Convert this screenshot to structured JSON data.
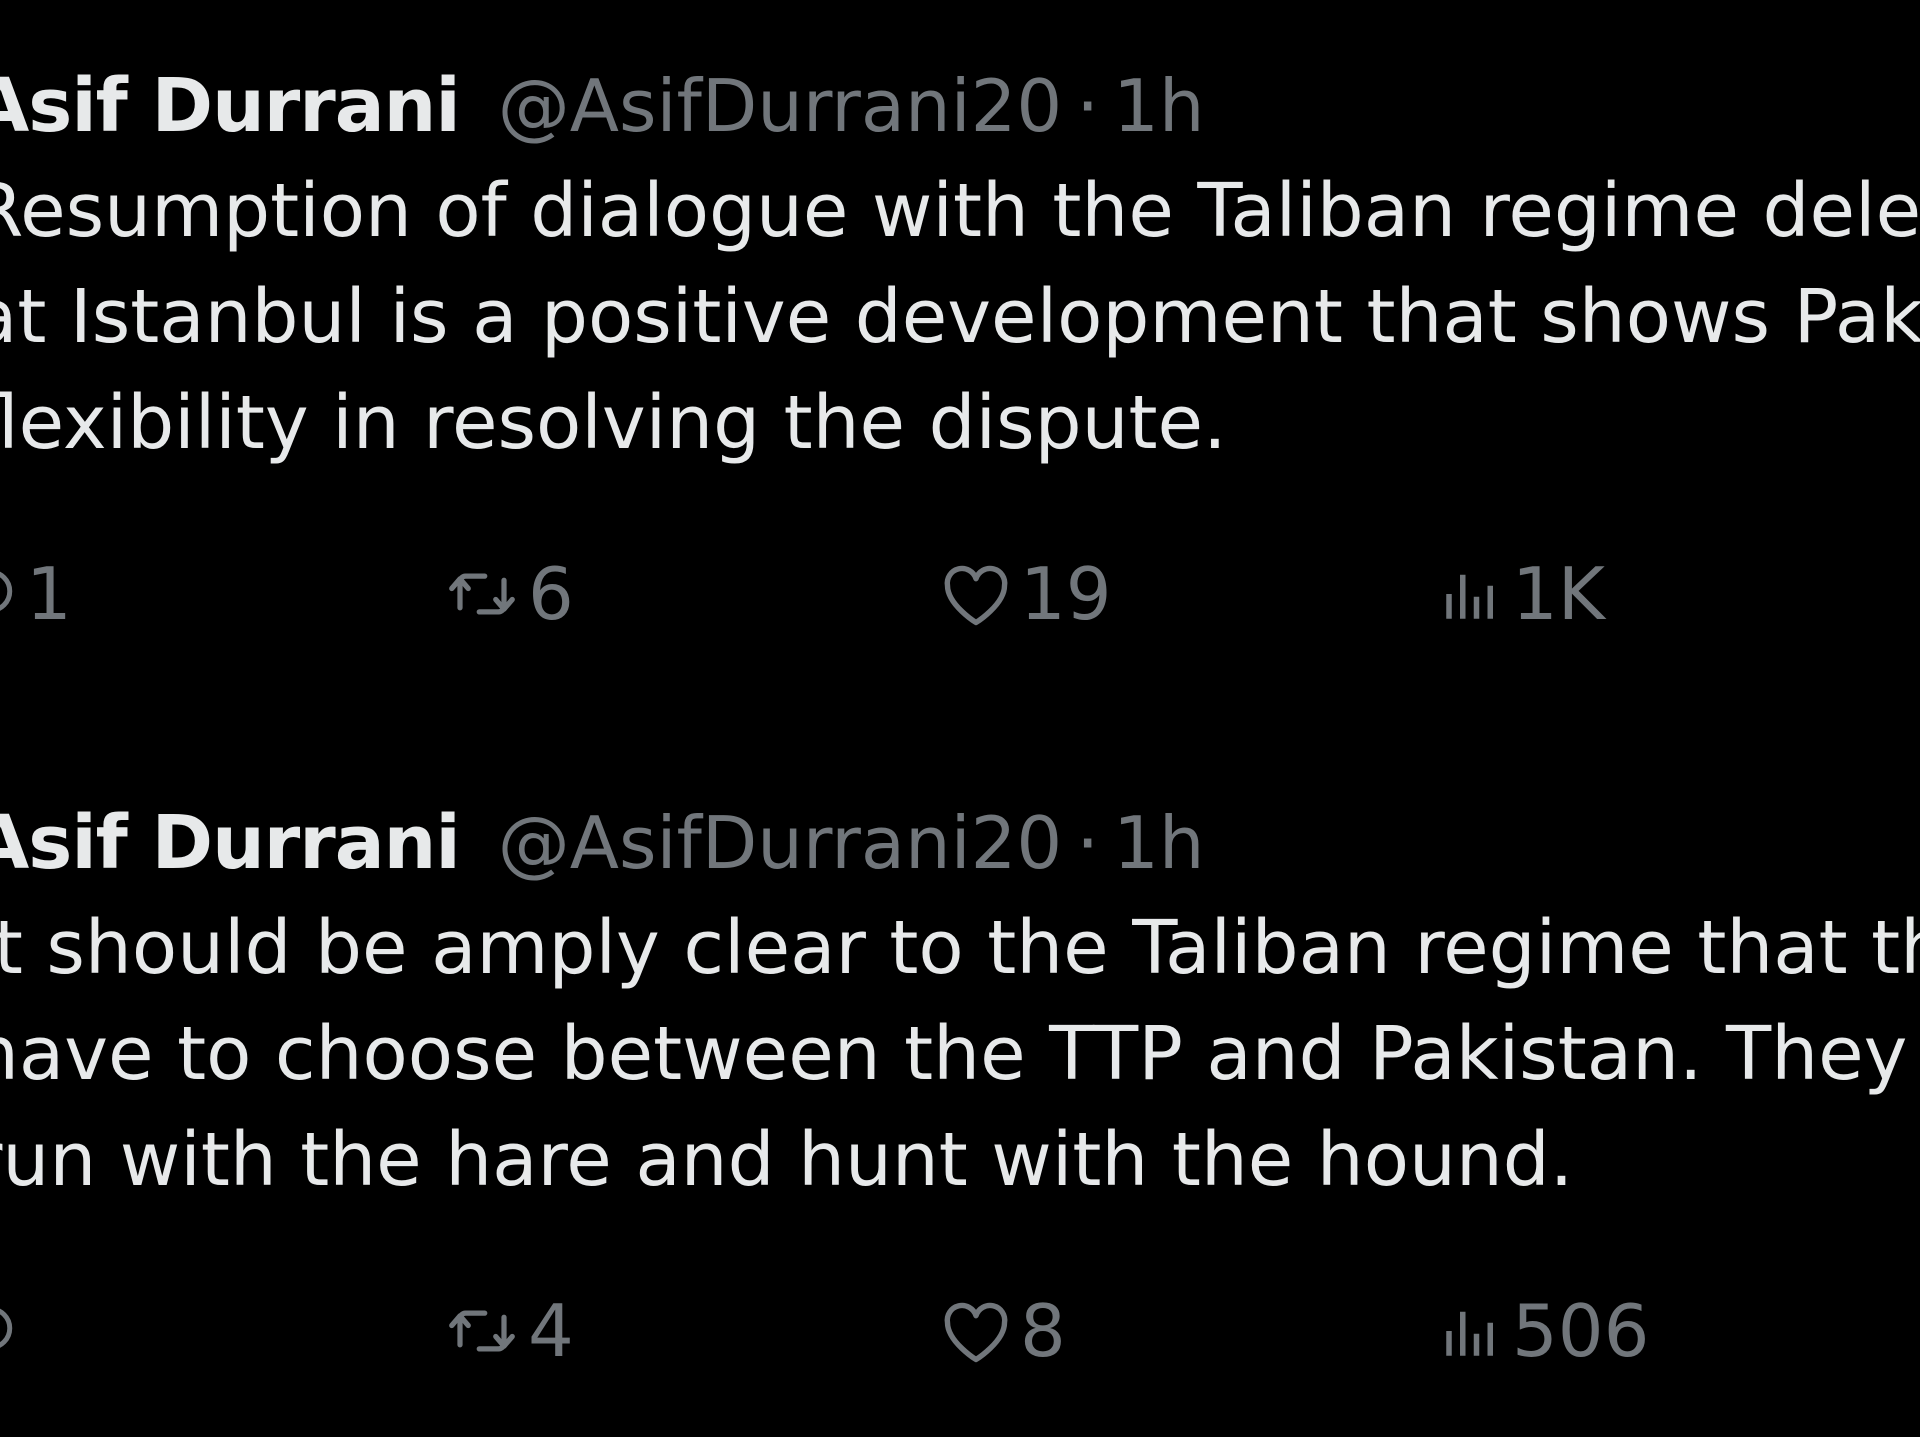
{
  "colors": {
    "background": "#000000",
    "primary_text": "#e7e9ea",
    "secondary_text": "#71767b"
  },
  "tweets": [
    {
      "author": {
        "display_name": "Asif Durrani",
        "handle": "@AsifDurrani20"
      },
      "separator": "·",
      "time": "1h",
      "text_lines": [
        "Resumption of dialogue with the Taliban regime dele",
        "at Istanbul is a positive development that shows Pak",
        "flexibility in resolving the dispute."
      ],
      "actions": {
        "reply": {
          "icon": "reply-icon",
          "count": "1"
        },
        "retweet": {
          "icon": "retweet-icon",
          "count": "6"
        },
        "like": {
          "icon": "heart-icon",
          "count": "19"
        },
        "views": {
          "icon": "views-bar-chart-icon",
          "count": "1K"
        }
      }
    },
    {
      "author": {
        "display_name": "Asif Durrani",
        "handle": "@AsifDurrani20"
      },
      "separator": "·",
      "time": "1h",
      "text_lines": [
        "It should be amply clear to the Taliban regime that th",
        "have to choose between the TTP and Pakistan. They",
        "run with the hare and hunt with the hound."
      ],
      "actions": {
        "reply": {
          "icon": "reply-icon",
          "count": ""
        },
        "retweet": {
          "icon": "retweet-icon",
          "count": "4"
        },
        "like": {
          "icon": "heart-icon",
          "count": "8"
        },
        "views": {
          "icon": "views-bar-chart-icon",
          "count": "506"
        }
      }
    }
  ]
}
